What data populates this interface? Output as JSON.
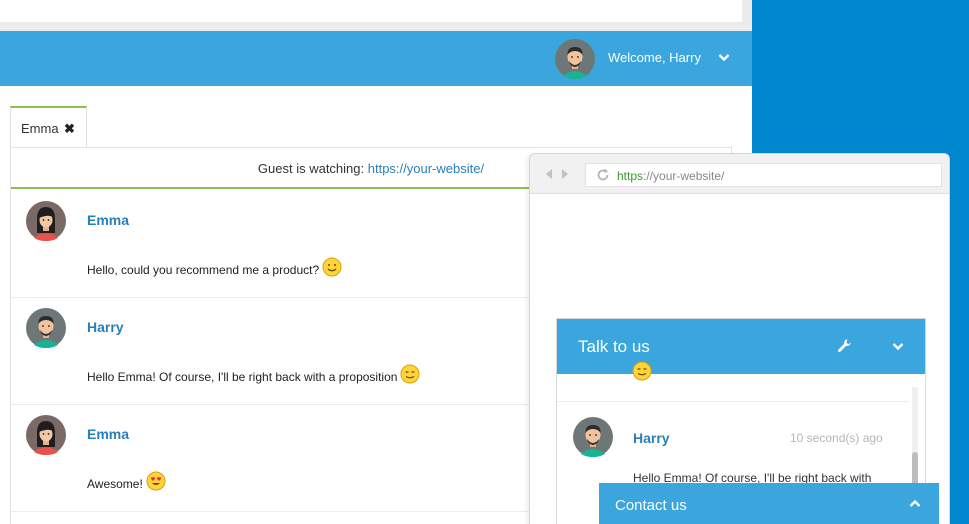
{
  "header": {
    "welcome_text": "Welcome, Harry",
    "user_avatar": "harry-avatar",
    "menu_icon": "chevron-down-icon"
  },
  "tabs": [
    {
      "label": "Emma",
      "close_icon": "✖"
    }
  ],
  "guest_bar": {
    "prefix": "Guest is watching:",
    "url": "https://your-website/"
  },
  "messages": [
    {
      "name": "Emma",
      "text": "Hello, could you recommend me a product?",
      "emoji": "smile-emoji",
      "avatar": "emma-avatar"
    },
    {
      "name": "Harry",
      "text": "Hello Emma! Of course, I'll be right back with a proposition",
      "emoji": "wink-emoji",
      "avatar": "harry-avatar"
    },
    {
      "name": "Emma",
      "text": "Awesome!",
      "emoji": "heart-eyes-emoji",
      "avatar": "emma-avatar"
    }
  ],
  "browser": {
    "url_scheme": "https",
    "url_rest": "://your-website/"
  },
  "widget": {
    "title": "Talk to us",
    "message": {
      "name": "Harry",
      "time": "10 second(s) ago",
      "text": "Hello Emma! Of course, I'll be right back with"
    }
  },
  "contact_bar": {
    "label": "Contact us"
  },
  "colors": {
    "brand_blue": "#3aa6dd",
    "desktop_blue": "#0087cf",
    "accent_green": "#8cc152",
    "link_blue": "#2a7fb8"
  }
}
